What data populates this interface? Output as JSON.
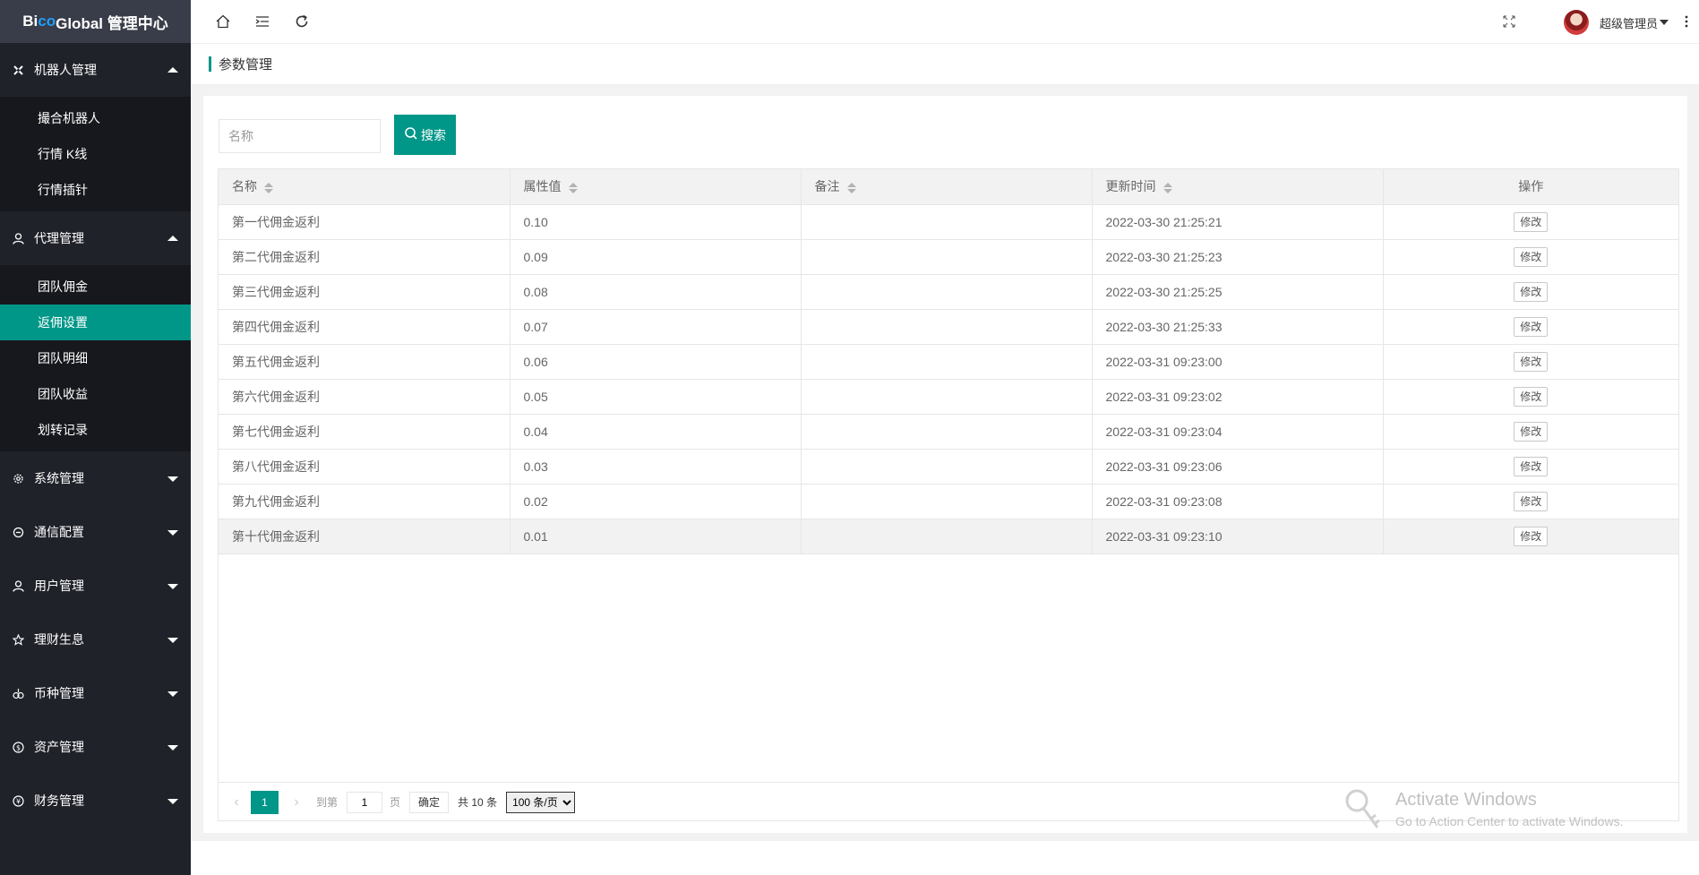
{
  "app": {
    "logo_prefix": "Bi",
    "logo_accent": "co",
    "logo_rest": " Global 管理中心",
    "accent_color": "#009688"
  },
  "topbar": {
    "user_name": "超级管理员"
  },
  "breadcrumb": {
    "title": "参数管理"
  },
  "sidebar": {
    "groups": [
      {
        "label": "机器人管理",
        "icon": "robot-icon",
        "expanded": true,
        "items": [
          "撮合机器人",
          "行情 K线",
          "行情插针"
        ]
      },
      {
        "label": "代理管理",
        "icon": "agent-icon",
        "expanded": true,
        "items": [
          "团队佣金",
          "返佣设置",
          "团队明细",
          "团队收益",
          "划转记录"
        ],
        "active_item": "返佣设置"
      },
      {
        "label": "系统管理",
        "icon": "gear-icon",
        "expanded": false
      },
      {
        "label": "通信配置",
        "icon": "signal-icon",
        "expanded": false
      },
      {
        "label": "用户管理",
        "icon": "user-icon",
        "expanded": false
      },
      {
        "label": "理财生息",
        "icon": "star-icon",
        "expanded": false
      },
      {
        "label": "币种管理",
        "icon": "coin-icon",
        "expanded": false
      },
      {
        "label": "资产管理",
        "icon": "dollar-icon",
        "expanded": false
      },
      {
        "label": "财务管理",
        "icon": "yen-icon",
        "expanded": false
      }
    ]
  },
  "search": {
    "placeholder": "名称",
    "button_label": "搜索"
  },
  "table": {
    "columns": [
      "名称",
      "属性值",
      "备注",
      "更新时间",
      "操作"
    ],
    "action_label": "修改",
    "rows": [
      {
        "name": "第一代佣金返利",
        "value": "0.10",
        "note": "",
        "updated": "2022-03-30 21:25:21"
      },
      {
        "name": "第二代佣金返利",
        "value": "0.09",
        "note": "",
        "updated": "2022-03-30 21:25:23"
      },
      {
        "name": "第三代佣金返利",
        "value": "0.08",
        "note": "",
        "updated": "2022-03-30 21:25:25"
      },
      {
        "name": "第四代佣金返利",
        "value": "0.07",
        "note": "",
        "updated": "2022-03-30 21:25:33"
      },
      {
        "name": "第五代佣金返利",
        "value": "0.06",
        "note": "",
        "updated": "2022-03-31 09:23:00"
      },
      {
        "name": "第六代佣金返利",
        "value": "0.05",
        "note": "",
        "updated": "2022-03-31 09:23:02"
      },
      {
        "name": "第七代佣金返利",
        "value": "0.04",
        "note": "",
        "updated": "2022-03-31 09:23:04"
      },
      {
        "name": "第八代佣金返利",
        "value": "0.03",
        "note": "",
        "updated": "2022-03-31 09:23:06"
      },
      {
        "name": "第九代佣金返利",
        "value": "0.02",
        "note": "",
        "updated": "2022-03-31 09:23:08"
      },
      {
        "name": "第十代佣金返利",
        "value": "0.01",
        "note": "",
        "updated": "2022-03-31 09:23:10"
      }
    ]
  },
  "pager": {
    "current_page": "1",
    "go_label": "到第",
    "go_value": "1",
    "page_unit": "页",
    "confirm_label": "确定",
    "total_label": "共 10 条",
    "page_size": "100 条/页"
  },
  "watermark": {
    "line1": "Activate Windows",
    "line2": "Go to Action Center to activate Windows."
  }
}
